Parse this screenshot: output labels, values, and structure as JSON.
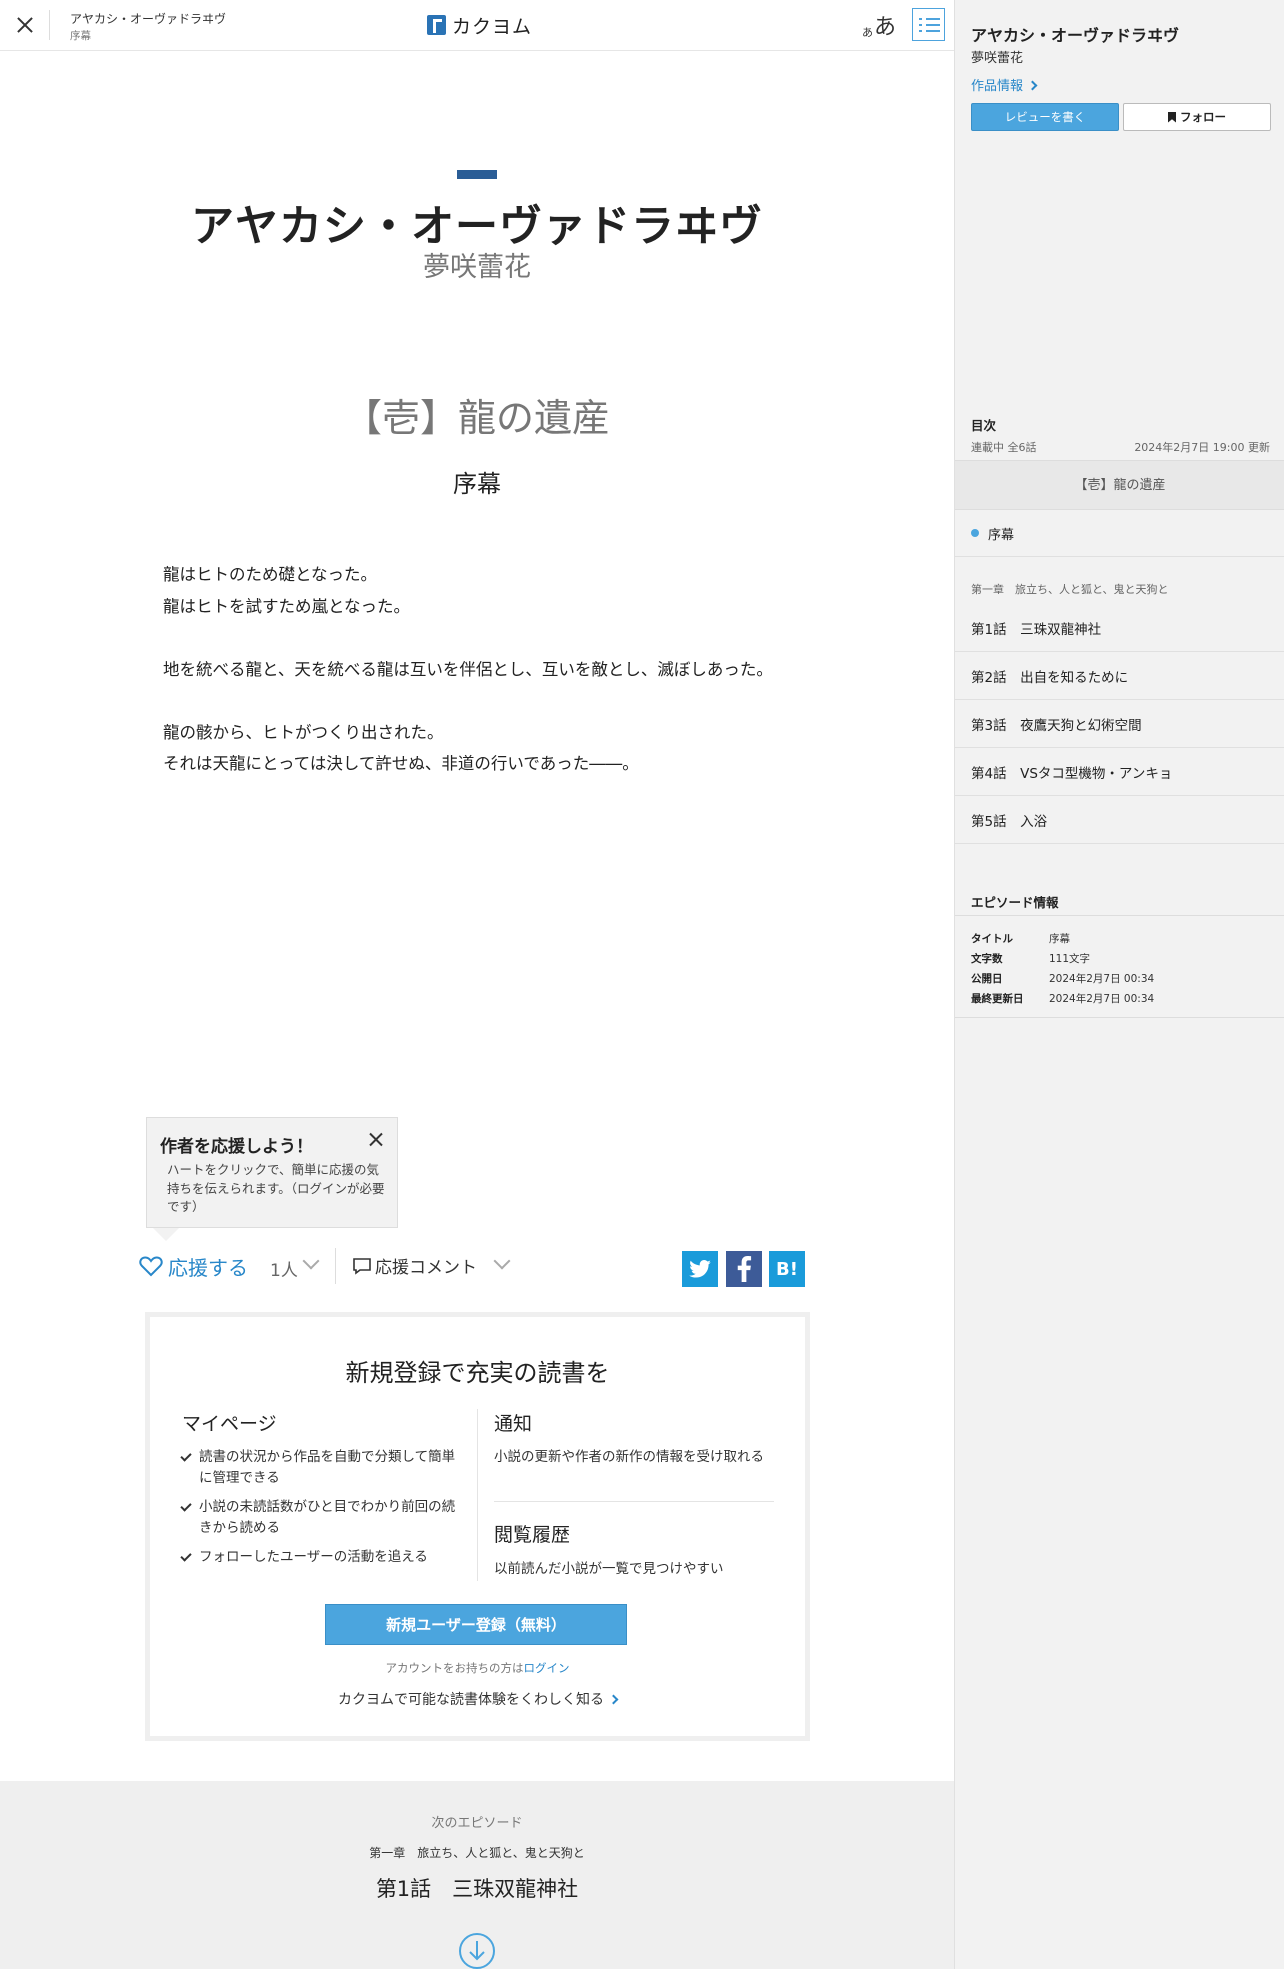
{
  "header": {
    "work_title": "アヤカシ・オーヴァドラヰヴ",
    "episode_title": "序幕",
    "logo_text": "カクヨム",
    "font_small": "あ",
    "font_big": "あ"
  },
  "main": {
    "work_title": "アヤカシ・オーヴァドラヰヴ",
    "author": "夢咲蕾花",
    "chapter_title": "【壱】龍の遺産",
    "episode_title": "序幕",
    "body_lines": [
      "龍はヒトのため礎となった。",
      "龍はヒトを試すため嵐となった。",
      "",
      "地を統べる龍と、天を統べる龍は互いを伴侶とし、互いを敵とし、滅ぼしあった。",
      "",
      "龍の骸から、ヒトがつくり出された。",
      "それは天龍にとっては決して許せぬ、非道の行いであった――。"
    ]
  },
  "tooltip": {
    "title": "作者を応援しよう！",
    "body": "ハートをクリックで、簡単に応援の気持ちを伝えられます。（ログインが必要です）"
  },
  "cheer": {
    "label": "応援する",
    "count": "1人",
    "comment_label": "応援コメント",
    "share": {
      "twitter": "t",
      "facebook": "f",
      "hatena": "B!"
    }
  },
  "signup": {
    "title": "新規登録で充実の読書を",
    "mypage": {
      "heading": "マイページ",
      "items": [
        "読書の状況から作品を自動で分類して簡単に管理できる",
        "小説の未読話数がひと目でわかり前回の続きから読める",
        "フォローしたユーザーの活動を追える"
      ]
    },
    "notify": {
      "heading": "通知",
      "desc": "小説の更新や作者の新作の情報を受け取れる"
    },
    "history": {
      "heading": "閲覧履歴",
      "desc": "以前読んだ小説が一覧で見つけやすい"
    },
    "register_button": "新規ユーザー登録（無料）",
    "login_prefix": "アカウントをお持ちの方は",
    "login_link": "ログイン",
    "learn_more": "カクヨムで可能な読書体験をくわしく知る"
  },
  "next": {
    "label": "次のエピソード",
    "chapter": "第一章　旅立ち、人と狐と、鬼と天狗と",
    "title": "第1話　三珠双龍神社"
  },
  "sidebar": {
    "title": "アヤカシ・オーヴァドラヰヴ",
    "author": "夢咲蕾花",
    "info_link": "作品情報",
    "review_button": "レビューを書く",
    "follow_button": "フォロー",
    "toc_label": "目次",
    "status": "連載中 全6話",
    "updated": "2024年2月7日 19:00 更新",
    "chapter_head": "【壱】龍の遺産",
    "current_episode": "序幕",
    "chapter1": "第一章　旅立ち、人と狐と、鬼と天狗と",
    "episodes": [
      "第1話　三珠双龍神社",
      "第2話　出自を知るために",
      "第3話　夜鷹天狗と幻術空間",
      "第4話　VSタコ型機物・アンキョ",
      "第5話　入浴"
    ],
    "episode_info_label": "エピソード情報",
    "episode_info": [
      {
        "key": "タイトル",
        "value": "序幕"
      },
      {
        "key": "文字数",
        "value": "111文字"
      },
      {
        "key": "公開日",
        "value": "2024年2月7日 00:34"
      },
      {
        "key": "最終更新日",
        "value": "2024年2月7日 00:34"
      }
    ]
  },
  "colors": {
    "accent": "#2887c9",
    "button_blue": "#4ba5de",
    "title_bar": "#2a5d96",
    "twitter": "#1a9bda",
    "facebook": "#3d5b98"
  }
}
